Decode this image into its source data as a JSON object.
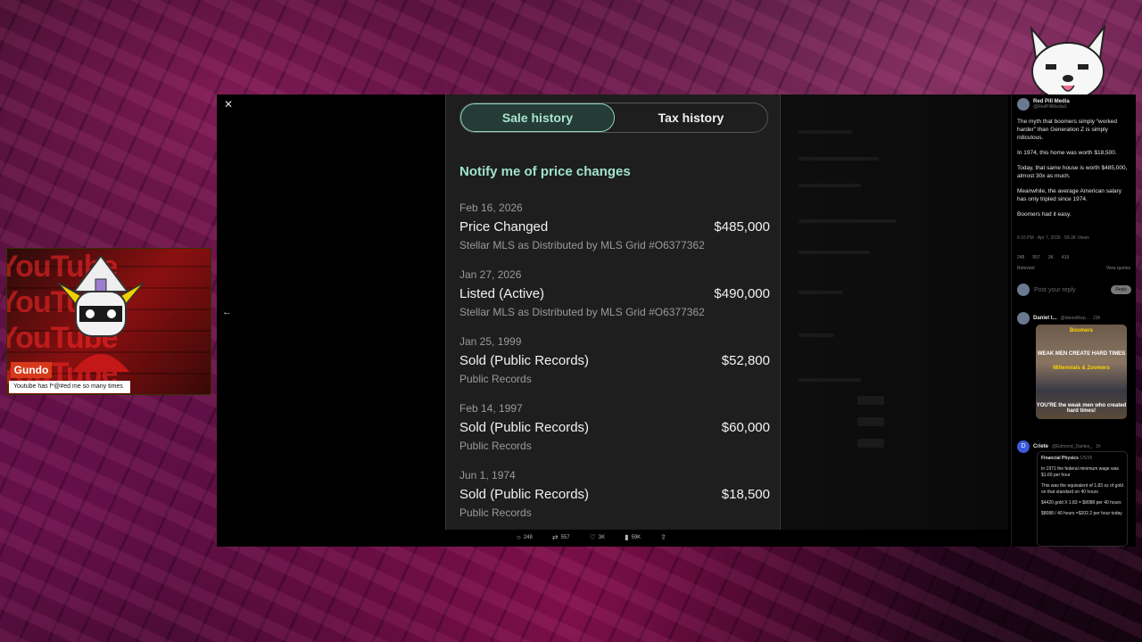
{
  "phone": {
    "tabs": [
      {
        "label": "Sale history",
        "active": true
      },
      {
        "label": "Tax history",
        "active": false
      }
    ],
    "notify_label": "Notify me of price changes",
    "events": [
      {
        "date": "Feb 16, 2026",
        "title": "Price Changed",
        "price": "$485,000",
        "source": "Stellar MLS as Distributed by MLS Grid #O6377362"
      },
      {
        "date": "Jan 27, 2026",
        "title": "Listed (Active)",
        "price": "$490,000",
        "source": "Stellar MLS as Distributed by MLS Grid #O6377362"
      },
      {
        "date": "Jan 25, 1999",
        "title": "Sold (Public Records)",
        "price": "$52,800",
        "source": "Public Records"
      },
      {
        "date": "Feb 14, 1997",
        "title": "Sold (Public Records)",
        "price": "$60,000",
        "source": "Public Records"
      },
      {
        "date": "Jun 1, 1974",
        "title": "Sold (Public Records)",
        "price": "$18,500",
        "source": "Public Records"
      }
    ]
  },
  "actions": {
    "replies": "248",
    "reposts": "557",
    "likes": "3K",
    "views": "59K"
  },
  "tweet": {
    "author": "Red Pill Media",
    "handle": "@RedPillMediaX",
    "paragraphs": [
      "The myth that boomers simply “worked harder” than Generation Z is simply ridiculous.",
      "In 1974, this home was worth $18,500.",
      "Today, that same house is worth $485,000, almost 30x as much.",
      "Meanwhile, the average American salary has only tripled since 1974.",
      "Boomers had it easy."
    ],
    "meta": "6:16 PM · Apr 7, 2026 · 59.3K Views",
    "stats": [
      "248",
      "557",
      "3K",
      "419"
    ],
    "relevant": "Relevant",
    "view_quotes": "View quotes",
    "reply_placeholder": "Post your reply",
    "reply_button": "Reply"
  },
  "reply1": {
    "author": "Daniel t...",
    "handle": "@danielthep...",
    "time": "23h",
    "meme_top": "Boomers",
    "meme_mid": "WEAK MEN CREATE HARD TIMES",
    "meme_mid2": "Millennials & Zoomers",
    "meme_bottom": "YOU'RE the weak men who created hard times!"
  },
  "reply2": {
    "avatar_letter": "D",
    "author": "Criete",
    "handle": "@Edmond_Dantes_",
    "time": "1h",
    "quote_author": "Financial Physics",
    "quote_date": "1/5/26",
    "quote_lines": [
      "In 1971 the federal minimum wage was $1.60 per hour",
      "This was the equivalent of 1.83 oz of gold on that standard on 40 hours",
      "$4420 gold X 1.83 = $8088 per 40 hours",
      "$8088 / 40 hours =$202.2 per hour today"
    ]
  },
  "stream": {
    "cam_text": "YouTube",
    "streamer_name": "Gundo",
    "caption": "Youtube has f*@#ed me so many times"
  },
  "colors": {
    "accent_mint": "#9fe3cb",
    "nameplate": "#d63a1a"
  }
}
